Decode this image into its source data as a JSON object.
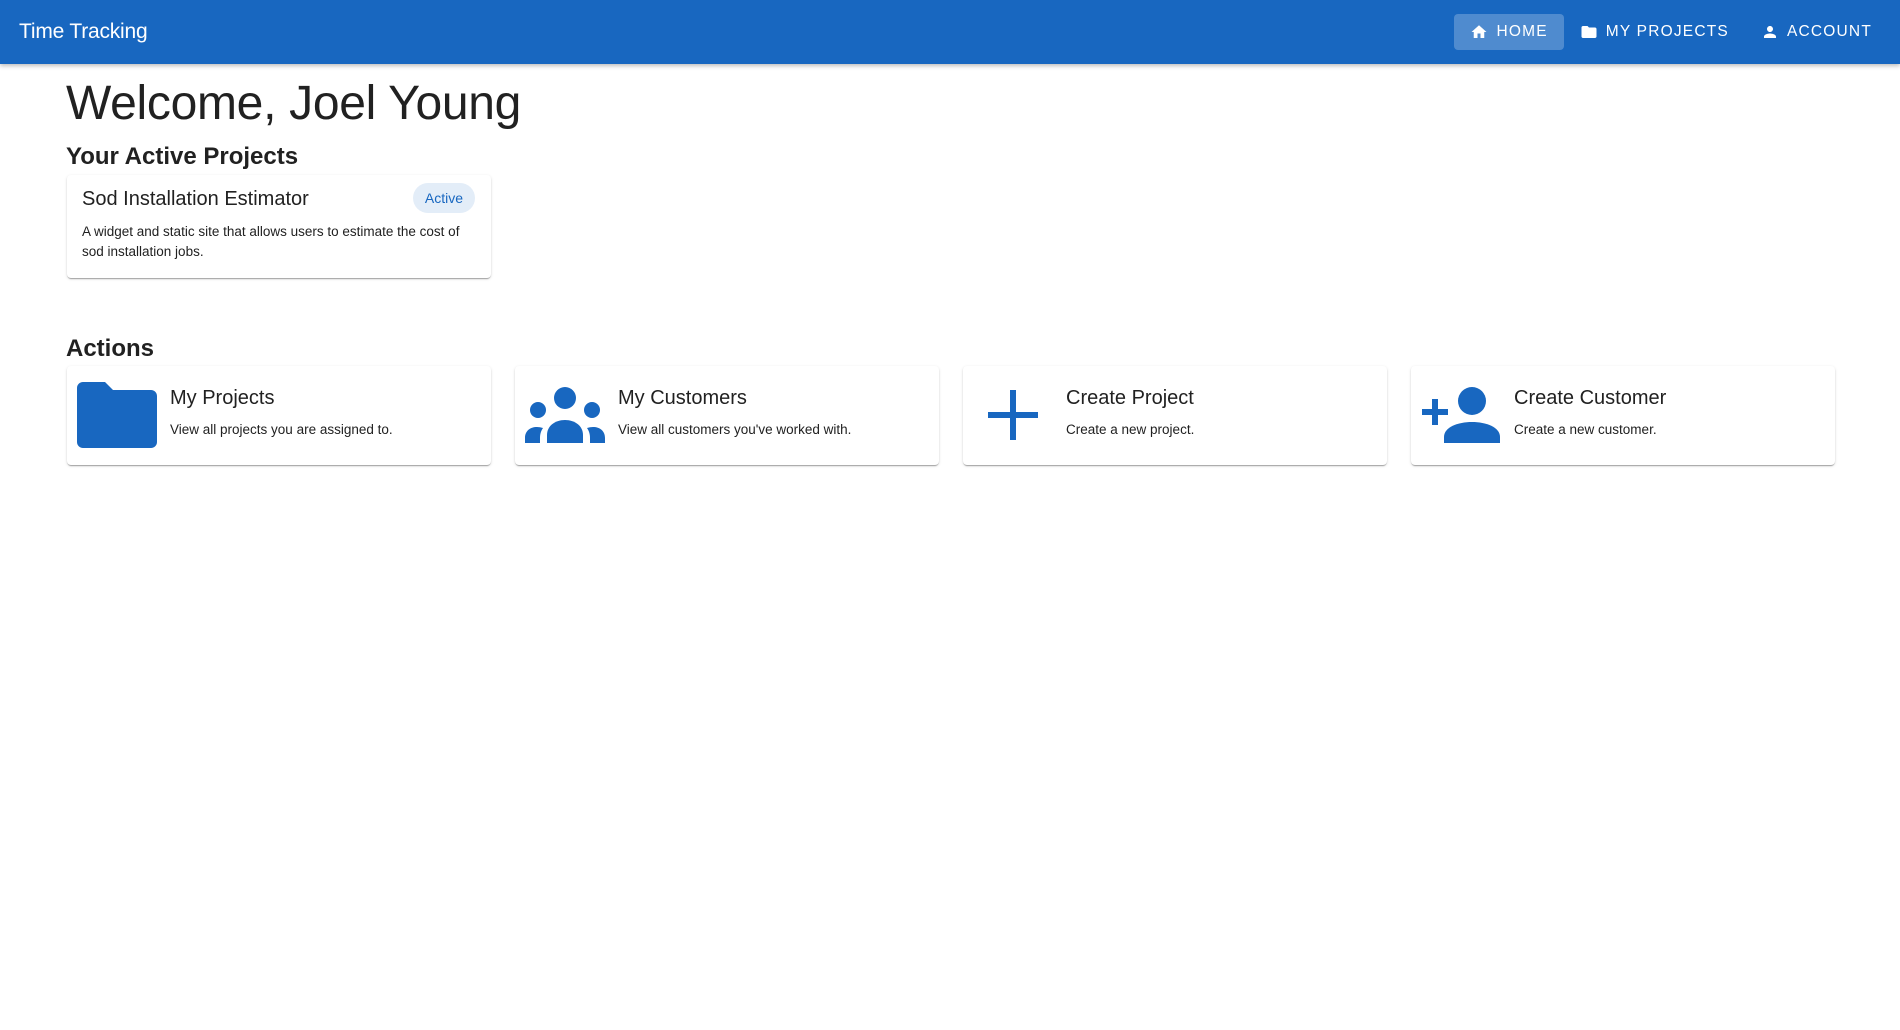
{
  "app": {
    "title": "Time Tracking"
  },
  "nav": {
    "items": [
      {
        "label": "Home",
        "icon": "home-icon",
        "active": true
      },
      {
        "label": "My Projects",
        "icon": "folder-icon",
        "active": false
      },
      {
        "label": "Account",
        "icon": "person-icon",
        "active": false
      }
    ]
  },
  "welcome": "Welcome, Joel Young",
  "active_projects": {
    "heading": "Your Active Projects",
    "items": [
      {
        "name": "Sod Installation Estimator",
        "status": "Active",
        "description": "A widget and static site that allows users to estimate the cost of sod installation jobs."
      }
    ]
  },
  "actions": {
    "heading": "Actions",
    "items": [
      {
        "title": "My Projects",
        "subtitle": "View all projects you are assigned to.",
        "icon": "folder-icon"
      },
      {
        "title": "My Customers",
        "subtitle": "View all customers you've worked with.",
        "icon": "group-icon"
      },
      {
        "title": "Create Project",
        "subtitle": "Create a new project.",
        "icon": "plus-icon"
      },
      {
        "title": "Create Customer",
        "subtitle": "Create a new customer.",
        "icon": "add-person-icon"
      }
    ]
  },
  "colors": {
    "primary": "#1867c0",
    "chip_bg": "#e3edf8",
    "text": "#212121"
  }
}
